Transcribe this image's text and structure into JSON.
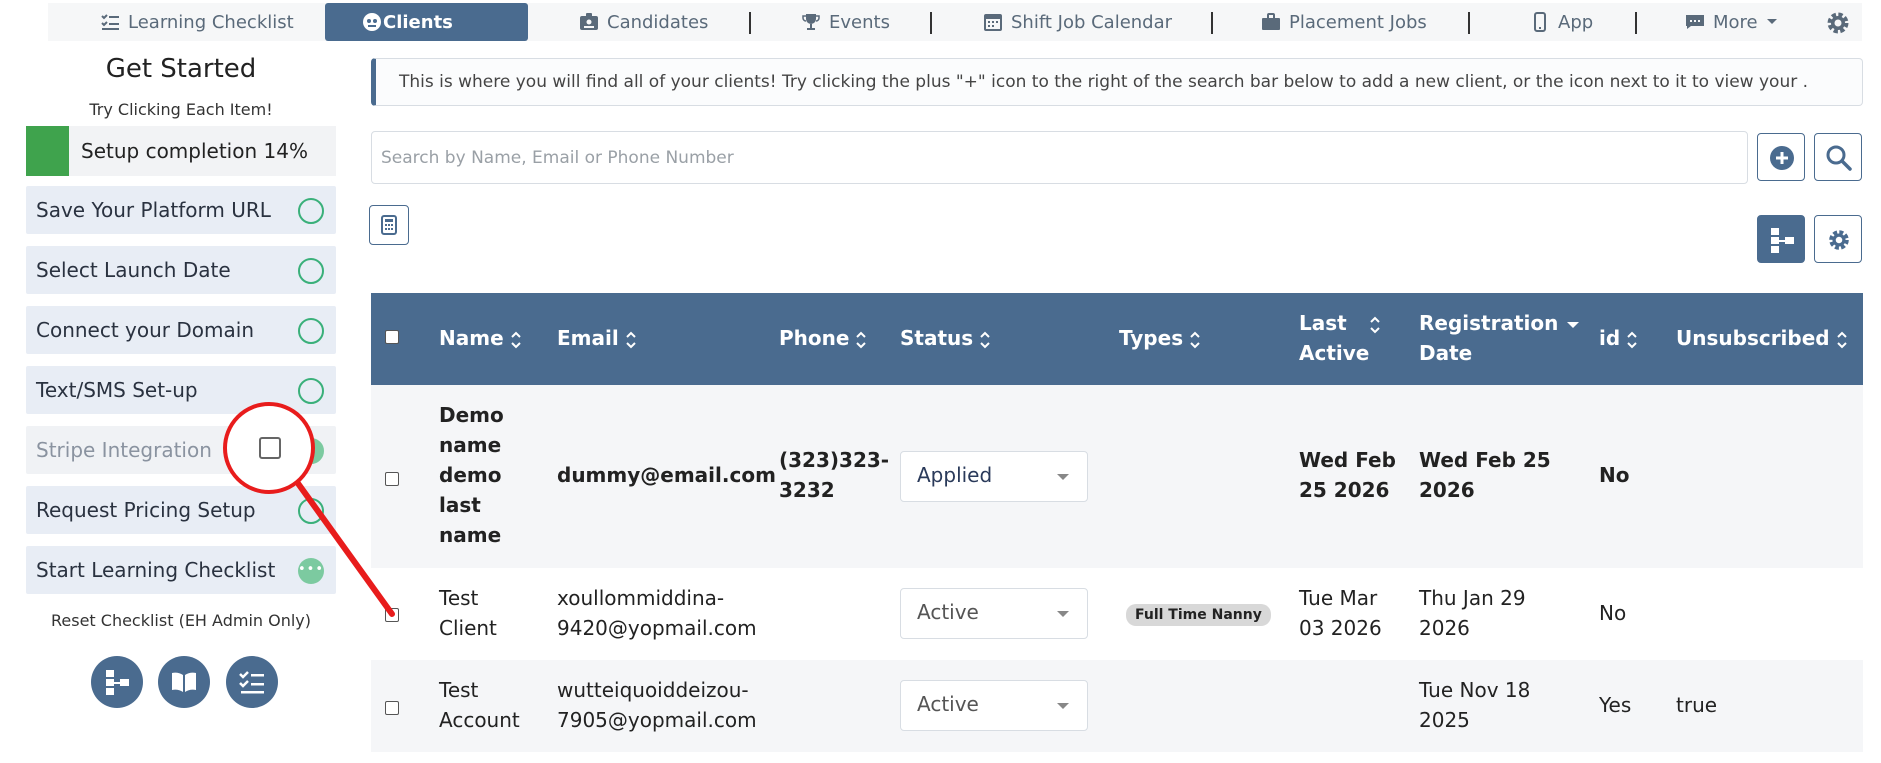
{
  "nav": {
    "items": [
      {
        "label": "Learning Checklist",
        "icon": "checklist-icon"
      },
      {
        "label": "Clients",
        "icon": "clients-icon"
      },
      {
        "label": "Candidates",
        "icon": "id-card-icon"
      },
      {
        "label": "Events",
        "icon": "trophy-icon"
      },
      {
        "label": "Shift Job Calendar",
        "icon": "calendar-icon"
      },
      {
        "label": "Placement Jobs",
        "icon": "briefcase-icon"
      },
      {
        "label": "App",
        "icon": "phone-icon"
      },
      {
        "label": "More",
        "icon": "chat-icon"
      }
    ],
    "active": "Clients",
    "accent": "#4a6b8f"
  },
  "sidebar": {
    "title": "Get Started",
    "subtitle": "Try Clicking Each Item!",
    "completion_label": "Setup completion 14%",
    "completion_percent": 14,
    "items": [
      {
        "label": "Save Your Platform URL",
        "state": "open"
      },
      {
        "label": "Select Launch Date",
        "state": "open"
      },
      {
        "label": "Connect your Domain",
        "state": "open"
      },
      {
        "label": "Text/SMS Set-up",
        "state": "open"
      },
      {
        "label": "Stripe Integration",
        "state": "done"
      },
      {
        "label": "Request Pricing Setup",
        "state": "open"
      },
      {
        "label": "Start Learning Checklist",
        "state": "in-progress"
      }
    ],
    "reset_label": "Reset Checklist (EH Admin Only)"
  },
  "banner": {
    "text": "This is where you will find all of your clients! Try clicking the plus \"+\" icon to the right of the search bar below to add a new client, or the icon next to it to view your ."
  },
  "search": {
    "placeholder": "Search by Name, Email or Phone Number"
  },
  "table": {
    "headers": {
      "name": "Name",
      "email": "Email",
      "phone": "Phone",
      "status": "Status",
      "types": "Types",
      "last_active_1": "Last",
      "last_active_2": "Active",
      "reg_1": "Registration",
      "reg_2": "Date",
      "id": "id",
      "unsubscribed": "Unsubscribed"
    },
    "rows": [
      {
        "name_lines": [
          "Demo",
          "name",
          "demo",
          "last",
          "name"
        ],
        "email": "dummy@email.com",
        "phone_lines": [
          "(323)323-",
          "3232"
        ],
        "status": "Applied",
        "type": "",
        "last_active_lines": [
          "Wed Feb",
          "25 2026"
        ],
        "reg_lines": [
          "Wed Feb 25",
          "2026"
        ],
        "id": "No",
        "unsubscribed": ""
      },
      {
        "name_lines": [
          "Test",
          "Client"
        ],
        "email_lines": [
          "xoullommiddina-",
          "9420@yopmail.com"
        ],
        "status": "Active",
        "type": "Full Time Nanny",
        "last_active_lines": [
          "Tue Mar",
          "03 2026"
        ],
        "reg_lines": [
          "Thu Jan 29",
          "2026"
        ],
        "id": "No",
        "unsubscribed": ""
      },
      {
        "name_lines": [
          "Test",
          "Account"
        ],
        "email_lines": [
          "wutteiquoiddeizou-",
          "7905@yopmail.com"
        ],
        "status": "Active",
        "type": "",
        "last_active_lines": [],
        "reg_lines": [
          "Tue Nov 18",
          "2025"
        ],
        "id": "Yes",
        "unsubscribed": "true"
      }
    ]
  }
}
